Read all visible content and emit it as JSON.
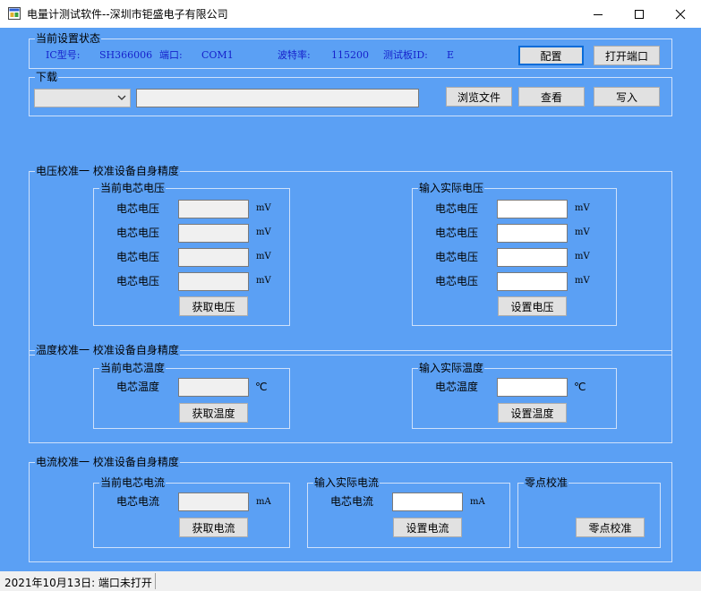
{
  "window": {
    "title": "电量计测试软件--深圳市钜盛电子有限公司"
  },
  "status_group": {
    "label": "当前设置状态",
    "ic_label": "IC型号:",
    "ic_value": "SH366006",
    "port_label": "端口:",
    "port_value": "COM1",
    "baud_label": "波特率:",
    "baud_value": "115200",
    "board_label": "测试板ID:",
    "board_value": "E",
    "config_button": "配置",
    "open_port_button": "打开端口"
  },
  "download_group": {
    "label": "下载",
    "file_path": "",
    "browse_button": "浏览文件",
    "view_button": "查看",
    "write_button": "写入"
  },
  "voltage_group": {
    "label": "电压校准一 校准设备自身精度",
    "current": {
      "label": "当前电芯电压",
      "rows": [
        {
          "label": "电芯电压",
          "unit": "mV",
          "value": ""
        },
        {
          "label": "电芯电压",
          "unit": "mV",
          "value": ""
        },
        {
          "label": "电芯电压",
          "unit": "mV",
          "value": ""
        },
        {
          "label": "电芯电压",
          "unit": "mV",
          "value": ""
        }
      ],
      "button": "获取电压"
    },
    "actual": {
      "label": "输入实际电压",
      "rows": [
        {
          "label": "电芯电压",
          "unit": "mV",
          "value": ""
        },
        {
          "label": "电芯电压",
          "unit": "mV",
          "value": ""
        },
        {
          "label": "电芯电压",
          "unit": "mV",
          "value": ""
        },
        {
          "label": "电芯电压",
          "unit": "mV",
          "value": ""
        }
      ],
      "button": "设置电压"
    }
  },
  "temperature_group": {
    "label": "温度校准一 校准设备自身精度",
    "current": {
      "label": "当前电芯温度",
      "row_label": "电芯温度",
      "unit": "℃",
      "button": "获取温度"
    },
    "actual": {
      "label": "输入实际温度",
      "row_label": "电芯温度",
      "unit": "℃",
      "button": "设置温度"
    }
  },
  "current_group": {
    "label": "电流校准一 校准设备自身精度",
    "current": {
      "label": "当前电芯电流",
      "row_label": "电芯电流",
      "unit": "mA",
      "button": "获取电流"
    },
    "actual": {
      "label": "输入实际电流",
      "row_label": "电芯电流",
      "unit": "mA",
      "button": "设置电流"
    },
    "zero": {
      "label": "零点校准",
      "button": "零点校准"
    }
  },
  "statusbar": {
    "text": "2021年10月13日: 端口未打开"
  },
  "colors": {
    "client_bg": "#5ba0f4",
    "value_text": "#1622cc",
    "focus_border": "#0a6cd8"
  }
}
